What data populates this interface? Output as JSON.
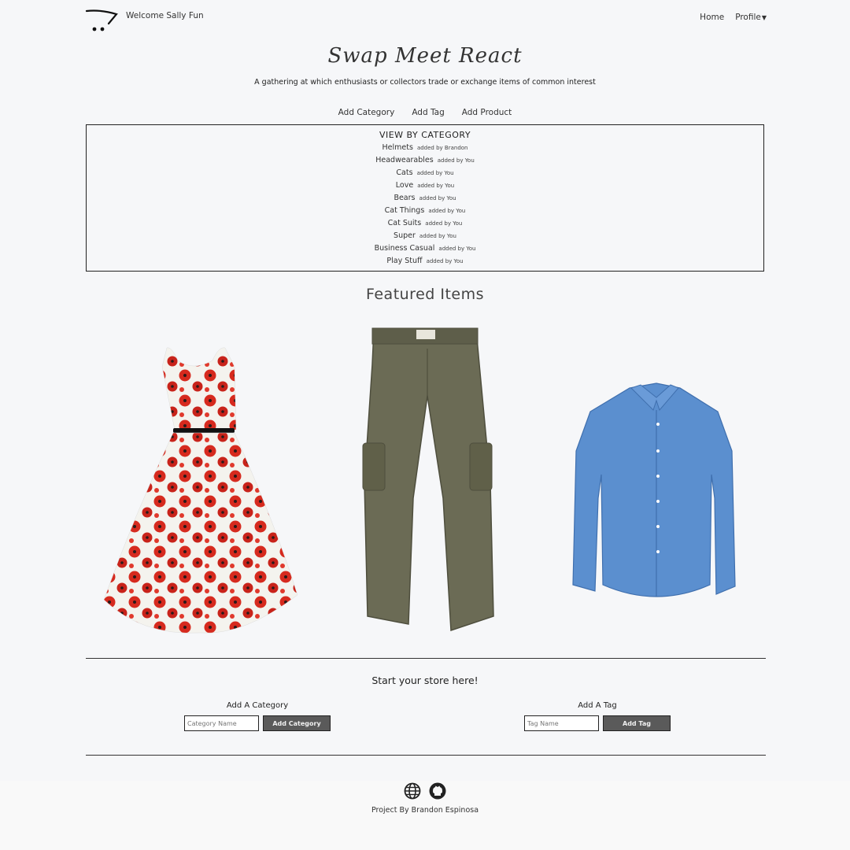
{
  "header": {
    "logo_icon": "shopping-cart-icon",
    "welcome": "Welcome Sally Fun",
    "nav": {
      "home": "Home",
      "profile": "Profile",
      "profile_icon": "chevron-down-icon"
    }
  },
  "hero": {
    "title": "Swap Meet React",
    "subtitle": "A gathering at which enthusiasts or collectors trade or exchange items of common interest"
  },
  "actions": {
    "add_category": "Add Category",
    "add_tag": "Add Tag",
    "add_product": "Add Product"
  },
  "categories": {
    "heading": "VIEW BY CATEGORY",
    "items": [
      {
        "name": "Helmets",
        "added": "added by Brandon"
      },
      {
        "name": "Headwearables",
        "added": "added by You"
      },
      {
        "name": "Cats",
        "added": "added by You"
      },
      {
        "name": "Love",
        "added": "added by You"
      },
      {
        "name": "Bears",
        "added": "added by You"
      },
      {
        "name": "Cat Things",
        "added": "added by You"
      },
      {
        "name": "Cat Suits",
        "added": "added by You"
      },
      {
        "name": "Super",
        "added": "added by You"
      },
      {
        "name": "Business Casual",
        "added": "added by You"
      },
      {
        "name": "Play Stuff",
        "added": "added by You"
      }
    ]
  },
  "featured": {
    "heading": "Featured Items",
    "products": [
      {
        "image": "floral-dress-image"
      },
      {
        "image": "cargo-pants-image"
      },
      {
        "image": "blue-shirt-image"
      }
    ]
  },
  "store": {
    "heading": "Start your store here!",
    "category_form": {
      "label": "Add A Category",
      "placeholder": "Category Name",
      "button": "Add Category"
    },
    "tag_form": {
      "label": "Add A Tag",
      "placeholder": "Tag Name",
      "button": "Add Tag"
    }
  },
  "footer": {
    "icons": [
      "globe-icon",
      "github-icon"
    ],
    "credit": "Project By Brandon Espinosa"
  },
  "colors": {
    "background": "#f6f7f9",
    "button": "#5a5a5a",
    "shirt": "#5b8fcf",
    "pants": "#6b6b55",
    "dress_print": "#d62a1e"
  }
}
